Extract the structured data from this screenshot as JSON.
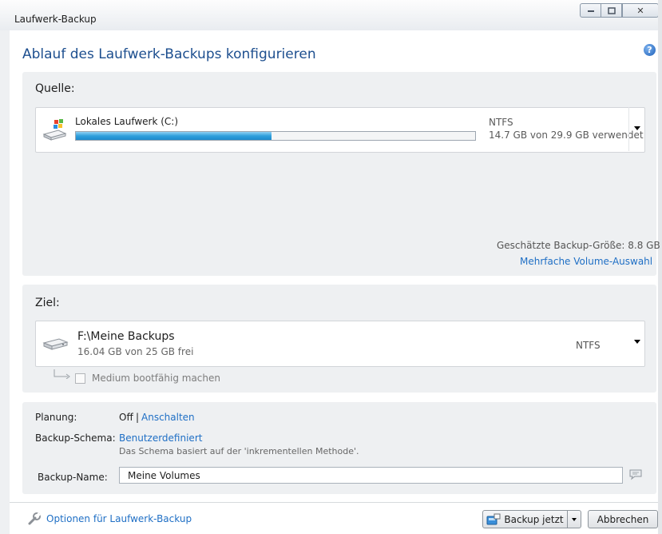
{
  "window": {
    "title": "Laufwerk-Backup",
    "close_glyph": "✕"
  },
  "header": {
    "title": "Ablauf des Laufwerk-Backups konfigurieren",
    "help_glyph": "?"
  },
  "source": {
    "label": "Quelle:",
    "drive": {
      "name": "Lokales Laufwerk (C:)",
      "filesystem": "NTFS",
      "usage_text": "14.7 GB von 29.9 GB verwendet",
      "used_fraction": 0.49,
      "icon": "windows-drive-icon"
    },
    "estimated_size": "Geschätzte Backup-Größe: 8.8 GB",
    "multi_volume_link": "Mehrfache Volume-Auswahl"
  },
  "target": {
    "label": "Ziel:",
    "drive": {
      "path": "F:\\Meine Backups",
      "free_text": "16.04 GB von 25 GB frei",
      "filesystem": "NTFS",
      "icon": "hard-drive-icon"
    },
    "bootable_label": "Medium bootfähig machen",
    "bootable_checked": false
  },
  "plan": {
    "planning_label": "Planung:",
    "planning_state": "Off",
    "planning_separator": "|",
    "planning_toggle": "Anschalten",
    "scheme_label": "Backup-Schema:",
    "scheme_value": "Benutzerdefiniert",
    "scheme_description": "Das Schema basiert auf der 'inkrementellen Methode'.",
    "name_label": "Backup-Name:",
    "name_value": "Meine Volumes"
  },
  "footer": {
    "options_link": "Optionen für Laufwerk-Backup",
    "backup_button": "Backup jetzt",
    "cancel_button": "Abbrechen"
  },
  "colors": {
    "accent_link": "#1f6fc5",
    "title_blue": "#1d4f8f",
    "panel_bg": "#eef0f2",
    "progress_blue": "#2f9fdc"
  }
}
